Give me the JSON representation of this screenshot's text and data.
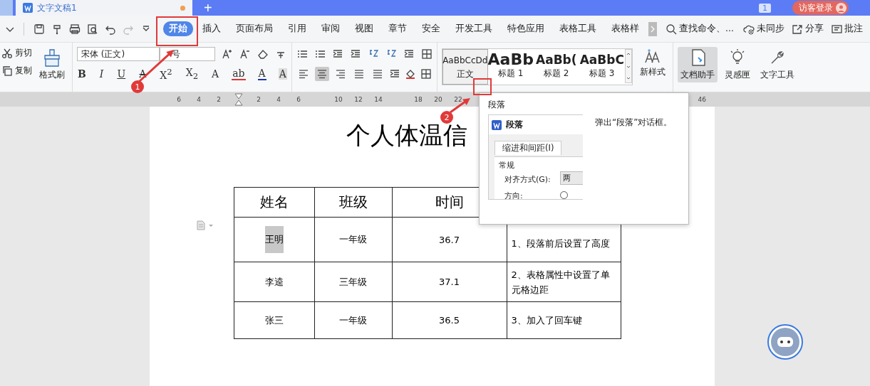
{
  "title_bar": {
    "tabs": [
      {
        "label": "文字文稿1",
        "selected": true
      }
    ],
    "new_tab": "+",
    "page_count": "1",
    "login_button": "访客登录"
  },
  "menu_bar": {
    "tabs": [
      {
        "label": "开始",
        "selected": true
      },
      {
        "label": "插入",
        "selected": false
      },
      {
        "label": "页面布局",
        "selected": false
      },
      {
        "label": "引用",
        "selected": false
      },
      {
        "label": "审阅",
        "selected": false
      },
      {
        "label": "视图",
        "selected": false
      },
      {
        "label": "章节",
        "selected": false
      },
      {
        "label": "安全",
        "selected": false
      },
      {
        "label": "开发工具",
        "selected": false
      },
      {
        "label": "特色应用",
        "selected": false
      },
      {
        "label": "表格工具",
        "selected": false
      },
      {
        "label": "表格样",
        "selected": false
      }
    ],
    "search": "查找命令、...",
    "actions": [
      "未同步",
      "分享",
      "批注"
    ]
  },
  "ribbon": {
    "clipboard": {
      "cut": "剪切",
      "copy": "复制",
      "format_painter": "格式刷"
    },
    "font": {
      "name": "宋体 (正文)",
      "size": "号",
      "buttons": [
        "B",
        "I",
        "U",
        "A",
        "X$^{2}$",
        "X$_{2}$",
        "A",
        "ab",
        "A",
        "A"
      ]
    },
    "alignment": [
      {
        "selected": false
      },
      {
        "selected": true
      },
      {
        "selected": false
      },
      {
        "selected": false
      },
      {
        "selected": false
      }
    ],
    "styles": [
      {
        "preview": "AaBbCcDd",
        "label": "正文",
        "selected": true
      },
      {
        "preview": "AaBb",
        "label": "标题 1",
        "selected": false
      },
      {
        "preview": "AaBb(",
        "label": "标题 2",
        "selected": false
      },
      {
        "preview": "AaBbC",
        "label": "标题 3",
        "selected": false
      }
    ],
    "new_style": "新样式",
    "tools": [
      {
        "label": "文档助手",
        "selected": true
      },
      {
        "label": "灵感匣",
        "selected": false
      },
      {
        "label": "文字工具",
        "selected": false
      }
    ]
  },
  "ruler": {
    "groups": [
      [
        "6",
        "4",
        "2"
      ],
      [
        "2",
        "4",
        "6"
      ],
      [
        "10",
        "12",
        "14"
      ],
      [
        "18",
        "20",
        "22"
      ]
    ],
    "end": "46"
  },
  "document": {
    "title": "个人体温信",
    "table": {
      "columns": [
        "姓名",
        "班级",
        "时间"
      ],
      "rows": [
        {
          "cells": [
            "王明",
            "一年级",
            "36.7",
            "1、段落前后设置了高度"
          ],
          "highlighted": true
        },
        {
          "cells": [
            "李逵",
            "三年级",
            "37.1",
            "2、表格属性中设置了单元格边距"
          ],
          "highlighted": false
        },
        {
          "cells": [
            "张三",
            "一年级",
            "36.5",
            "3、加入了回车键"
          ],
          "highlighted": false
        }
      ]
    }
  },
  "tooltip": {
    "title": "段落",
    "preview_title": "段落",
    "preview_tab": "缩进和间距(I)",
    "preview_section": "常规",
    "preview_align_label": "对齐方式(G):",
    "preview_align_value": "两",
    "preview_direction_label": "方向:",
    "description": "弹出“段落”对话框。"
  },
  "annotations": [
    {
      "number": "1"
    },
    {
      "number": "2"
    }
  ]
}
